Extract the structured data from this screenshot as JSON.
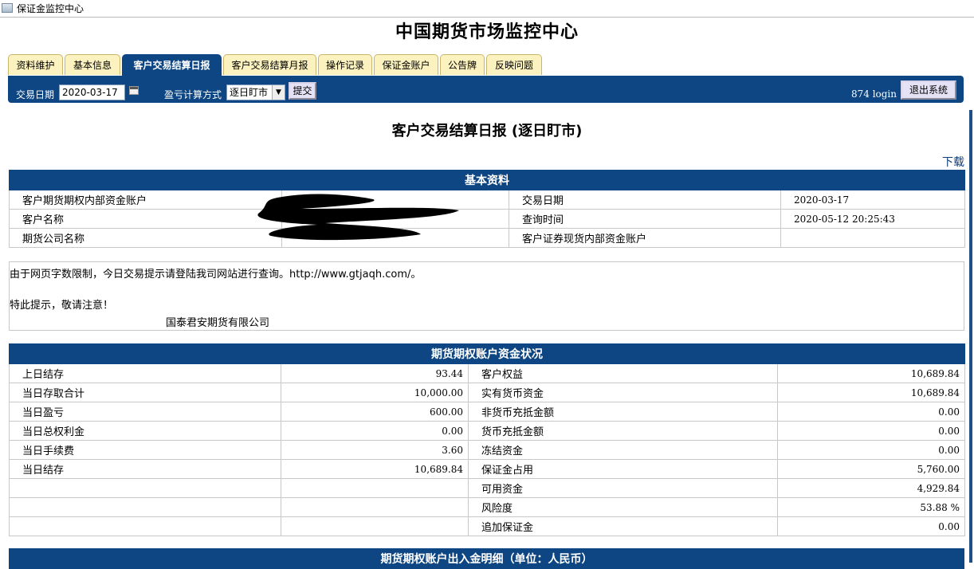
{
  "window": {
    "title": "保证金监控中心"
  },
  "header": {
    "title": "中国期货市场监控中心"
  },
  "tabs": [
    {
      "label": "资料维护"
    },
    {
      "label": "基本信息"
    },
    {
      "label": "客户交易结算日报",
      "active": true
    },
    {
      "label": "客户交易结算月报"
    },
    {
      "label": "操作记录"
    },
    {
      "label": "保证金账户"
    },
    {
      "label": "公告牌"
    },
    {
      "label": "反映问题"
    }
  ],
  "toolbar": {
    "date_label": "交易日期",
    "date_value": "2020-03-17",
    "method_label": "盈亏计算方式",
    "method_value": "逐日盯市",
    "submit_label": "提交",
    "login_text": "874 login",
    "logout_label": "退出系统"
  },
  "report": {
    "title": "客户交易结算日报 (逐日盯市)",
    "download_label": "下载"
  },
  "basic": {
    "header": "基本资料",
    "rows": [
      {
        "label": "客户期货期权内部资金账户",
        "value": "",
        "label2": "交易日期",
        "value2": "2020-03-17"
      },
      {
        "label": "客户名称",
        "value": "",
        "label2": "查询时间",
        "value2": "2020-05-12 20:25:43"
      },
      {
        "label": "期货公司名称",
        "value": "",
        "label2": "客户证券现货内部资金账户",
        "value2": ""
      }
    ]
  },
  "notice": {
    "line1": "由于网页字数限制，今日交易提示请登陆我司网站进行查询。http://www.gtjaqh.com/。",
    "line2": "特此提示，敬请注意！",
    "signature": "国泰君安期货有限公司"
  },
  "funds": {
    "header": "期货期权账户资金状况",
    "rows": [
      {
        "l1": "上日结存",
        "v1": "93.44",
        "l2": "客户权益",
        "v2": "10,689.84"
      },
      {
        "l1": "当日存取合计",
        "v1": "10,000.00",
        "l2": "实有货币资金",
        "v2": "10,689.84"
      },
      {
        "l1": "当日盈亏",
        "v1": "600.00",
        "l2": "非货币充抵金额",
        "v2": "0.00"
      },
      {
        "l1": "当日总权利金",
        "v1": "0.00",
        "l2": "货币充抵金额",
        "v2": "0.00"
      },
      {
        "l1": "当日手续费",
        "v1": "3.60",
        "l2": "冻结资金",
        "v2": "0.00"
      },
      {
        "l1": "当日结存",
        "v1": "10,689.84",
        "l2": "保证金占用",
        "v2": "5,760.00"
      },
      {
        "l1": "",
        "v1": "",
        "l2": "可用资金",
        "v2": "4,929.84"
      },
      {
        "l1": "",
        "v1": "",
        "l2": "风险度",
        "v2": "53.88 %"
      },
      {
        "l1": "",
        "v1": "",
        "l2": "追加保证金",
        "v2": "0.00"
      }
    ]
  },
  "deposits": {
    "header": "期货期权账户出入金明细（单位：人民币）"
  }
}
